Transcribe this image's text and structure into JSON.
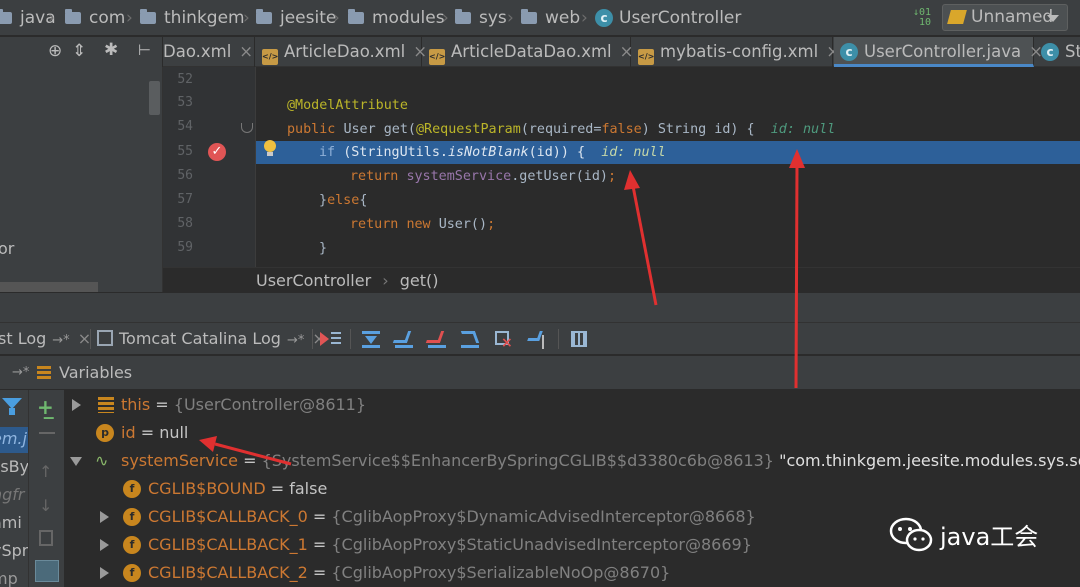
{
  "breadcrumbs": [
    "java",
    "com",
    "thinkgem",
    "jeesite",
    "modules",
    "sys",
    "web",
    "UserController"
  ],
  "run_config": "Unnamed",
  "editor_tabs": [
    "Dao.xml",
    "ArticleDao.xml",
    "ArticleDataDao.xml",
    "mybatis-config.xml",
    "UserController.java",
    "St"
  ],
  "code": {
    "line_numbers": [
      "52",
      "53",
      "54",
      "55",
      "56",
      "57",
      "58",
      "59"
    ],
    "annotation": "@ModelAttribute",
    "line54_a": "public ",
    "line54_b": "User ",
    "line54_c": "get(",
    "line54_d": "@RequestParam",
    "line54_e": "(required=",
    "line54_f": "false",
    "line54_g": ") String id) {",
    "line54_inline": "id: null",
    "line55_a": "if ",
    "line55_b": "(StringUtils.",
    "line55_c": "isNotBlank",
    "line55_d": "(id)) {",
    "line55_inline": "id: null",
    "line56_a": "return ",
    "line56_b": "systemService",
    "line56_c": ".getUser(id)",
    "line56_d": ";",
    "line57_a": "}",
    "line57_b": "else",
    "line57_c": "{",
    "line58_a": "return ",
    "line58_b": "new ",
    "line58_c": "User()",
    "line58_d": ";",
    "line59": "}"
  },
  "editor_breadcrumb": {
    "class": "UserController",
    "method": "get()"
  },
  "debug_tabs": [
    "st Log",
    "Tomcat Catalina Log"
  ],
  "variables_title": "Variables",
  "left_strip_text": [
    "em.j",
    "ssBy",
    "ngfr",
    "ami",
    "ySpr",
    "mp"
  ],
  "variables": [
    {
      "name": "this",
      "eq": " = ",
      "value": "{UserController@8611}"
    },
    {
      "name": "id",
      "eq": " = ",
      "value": "null"
    },
    {
      "name": "systemService",
      "eq": " = ",
      "value": "{SystemService$$EnhancerBySpringCGLIB$$d3380c6b@8613}",
      "extra": "\"com.thinkgem.jeesite.modules.sys.service.Syste"
    },
    {
      "name": "CGLIB$BOUND",
      "eq": " = ",
      "value": "false"
    },
    {
      "name": "CGLIB$CALLBACK_0",
      "eq": " = ",
      "value": "{CglibAopProxy$DynamicAdvisedInterceptor@8668}"
    },
    {
      "name": "CGLIB$CALLBACK_1",
      "eq": " = ",
      "value": "{CglibAopProxy$StaticUnadvisedInterceptor@8669}"
    },
    {
      "name": "CGLIB$CALLBACK_2",
      "eq": " = ",
      "value": "{CglibAopProxy$SerializableNoOp@8670}"
    }
  ],
  "watermark": "java工会",
  "colors": {
    "accent": "#2d6099",
    "arrow": "#e03030",
    "breakpoint": "#e05555"
  },
  "icons": [
    "folder-icon",
    "class-icon",
    "xml-icon",
    "breakpoint-icon",
    "bulb-icon",
    "filter-icon",
    "field-icon",
    "parameter-icon",
    "wechat-icon"
  ]
}
